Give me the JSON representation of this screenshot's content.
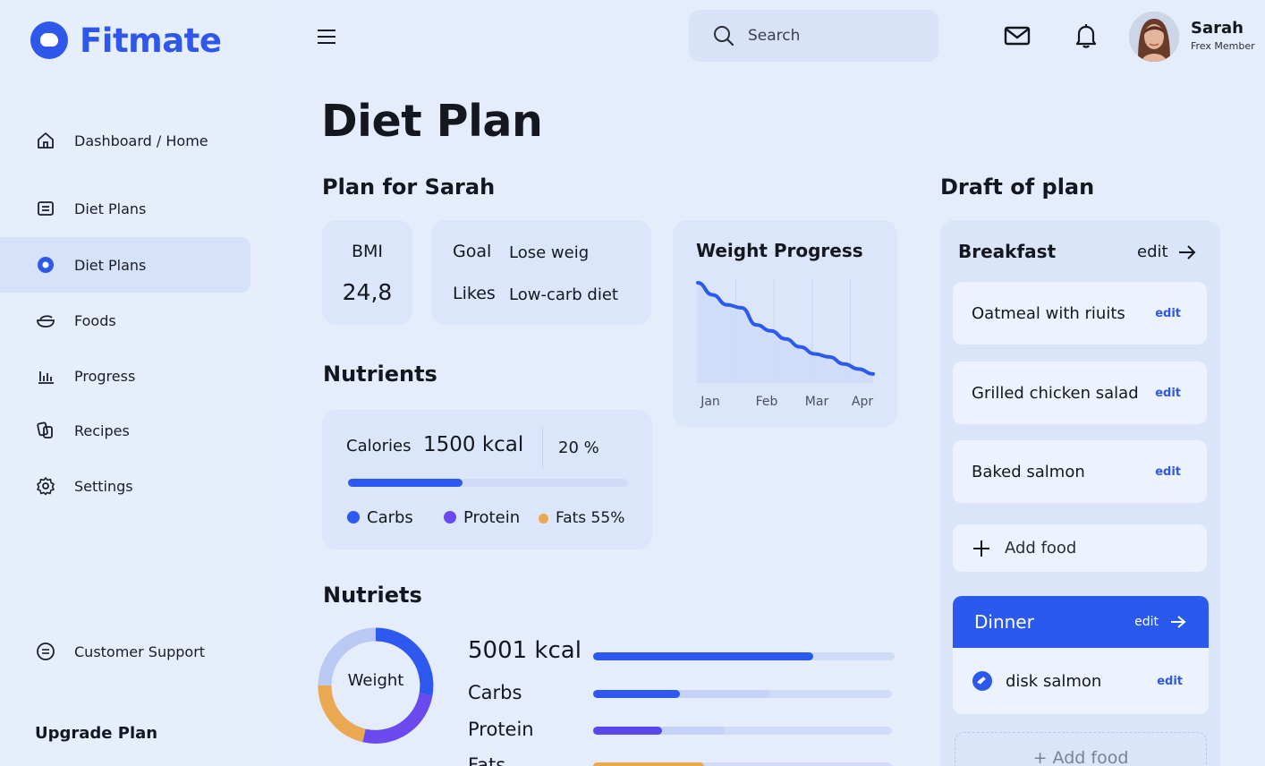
{
  "app": {
    "name": "Fitmate"
  },
  "sidebar": {
    "items": [
      {
        "label": "Dashboard / Home",
        "icon": "home-icon"
      },
      {
        "label": "Diet Plans",
        "icon": "list-icon"
      },
      {
        "label": "Diet Plans",
        "icon": "dot-icon",
        "active": true
      },
      {
        "label": "Foods",
        "icon": "bowl-icon"
      },
      {
        "label": "Progress",
        "icon": "bar-chart-icon"
      },
      {
        "label": "Recipes",
        "icon": "recipes-icon"
      },
      {
        "label": "Settings",
        "icon": "gear-icon"
      }
    ],
    "support": {
      "label": "Customer Support",
      "icon": "support-icon"
    },
    "upgrade": "Upgrade Plan"
  },
  "header": {
    "search_placeholder": "Search",
    "user": {
      "name": "Sarah",
      "role": "Frex Member"
    }
  },
  "page": {
    "title": "Diet Plan",
    "plan_heading": "Plan for Sarah",
    "draft_heading": "Draft of plan"
  },
  "bmi": {
    "label": "BMI",
    "value": "24,8"
  },
  "goal": {
    "goal_label": "Goal",
    "goal_value": "Lose weig",
    "likes_label": "Likes",
    "likes_value": "Low-carb diet"
  },
  "weight_progress": {
    "title": "Weight Progress"
  },
  "nutrients": {
    "heading": "Nutrients",
    "calories_label": "Calories",
    "calories_value": "1500 kcal",
    "percent": "20 %",
    "progress": 0.41,
    "legend": [
      {
        "label": "Carbs",
        "color": "#2d59ef"
      },
      {
        "label": "Protein",
        "color": "#6a49ee"
      },
      {
        "label": "Fats 55%",
        "color": "#eaa951"
      }
    ]
  },
  "nutriets": {
    "heading": "Nutriets",
    "donut_label": "Weight",
    "rows": [
      {
        "label": "5001 kcal",
        "fill": 0.73,
        "secondary": 0,
        "color": "#2d59ef"
      },
      {
        "label": "Carbs",
        "fill": 0.29,
        "secondary": 0.59,
        "color": "#2d59ef"
      },
      {
        "label": "Protein",
        "fill": 0.23,
        "secondary": 0.44,
        "color": "#5b45ec"
      },
      {
        "label": "Fats",
        "fill": 0.37,
        "secondary": 0,
        "color": "#eaa951"
      }
    ]
  },
  "draft": {
    "breakfast": {
      "title": "Breakfast",
      "edit": "edit",
      "items": [
        {
          "name": "Oatmeal with riuits",
          "edit": "edit"
        },
        {
          "name": "Grilled chicken salad",
          "edit": "edit"
        },
        {
          "name": "Baked salmon",
          "edit": "edit"
        }
      ],
      "add_food": "Add food"
    },
    "dinner": {
      "title": "Dinner",
      "edit": "edit",
      "items": [
        {
          "name": "disk salmon",
          "edit": "edit"
        }
      ],
      "add_food": "+ Add food"
    }
  },
  "chart_data": {
    "type": "area",
    "title": "Weight Progress",
    "categories": [
      "Jan",
      "Feb",
      "Mar",
      "Apr"
    ],
    "series": [
      {
        "values": [
          10,
          8.8,
          7.8,
          7.5,
          5.8,
          5.2,
          4.4,
          3.6,
          2.9,
          2.6,
          1.9,
          1.4,
          0.9
        ]
      }
    ],
    "grid": true
  },
  "colors": {
    "accent": "#2f57ea",
    "background": "#e5edfc",
    "card": "#dce6fa"
  }
}
